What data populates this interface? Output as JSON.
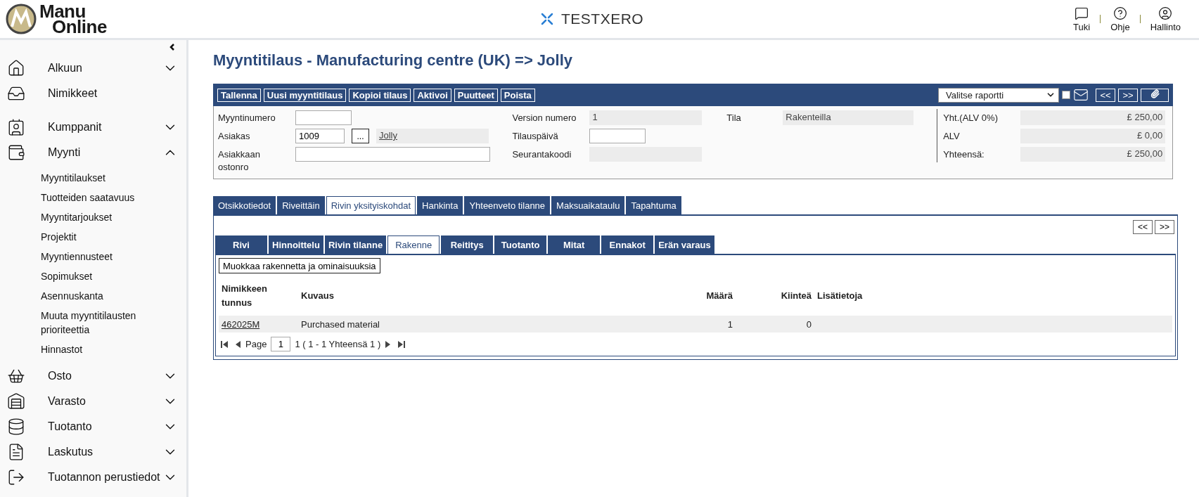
{
  "header": {
    "logo": {
      "line1": "Manu",
      "line2": "Online"
    },
    "brand": "TESTXERO",
    "actions": [
      {
        "label": "Tuki"
      },
      {
        "label": "Ohje"
      },
      {
        "label": "Hallinto"
      }
    ]
  },
  "sidebar": {
    "items": [
      {
        "label": "Alkuun",
        "expanded": false
      },
      {
        "label": "Nimikkeet"
      },
      {
        "label": "Kumppanit",
        "expanded": false
      },
      {
        "label": "Myynti",
        "expanded": true,
        "children": [
          "Myyntitilaukset",
          "Tuotteiden saatavuus",
          "Myyntitarjoukset",
          "Projektit",
          "Myyntiennusteet",
          "Sopimukset",
          "Asennuskanta",
          "Muuta myyntitilausten prioriteettia",
          "Hinnastot"
        ]
      },
      {
        "label": "Osto",
        "expanded": false
      },
      {
        "label": "Varasto",
        "expanded": false
      },
      {
        "label": "Tuotanto",
        "expanded": false
      },
      {
        "label": "Laskutus",
        "expanded": false
      },
      {
        "label": "Tuotannon perustiedot",
        "expanded": false
      }
    ]
  },
  "page_title": "Myyntitilaus - Manufacturing centre (UK) => Jolly",
  "toolbar": {
    "buttons": [
      "Tallenna",
      "Uusi myyntitilaus",
      "Kopioi tilaus",
      "Aktivoi",
      "Puutteet",
      "Poista"
    ],
    "report_select": "Valitse raportti",
    "email_checked": false,
    "nav": [
      "<<",
      ">>"
    ]
  },
  "form": {
    "customer": [
      {
        "label": "Myyntinumero",
        "kind": "input"
      },
      {
        "label": "Asiakas",
        "kind": "lookup",
        "value": "1009",
        "button": "...",
        "name": "Jolly"
      },
      {
        "label": "Asiakkaan ostonro",
        "kind": "wide"
      }
    ],
    "details": [
      {
        "label": "Version numero",
        "kind": "readonly",
        "value": "1"
      },
      {
        "label": "Tilauspäivä",
        "kind": "input"
      },
      {
        "label": "Seurantakoodi",
        "kind": "readonly"
      }
    ],
    "status": [
      {
        "label": "Tila",
        "kind": "readonly",
        "value": "Rakenteilla"
      }
    ],
    "totals": [
      {
        "label": "Yht.(ALV 0%)",
        "value": "£ 250,00"
      },
      {
        "label": "ALV",
        "value": "£ 0,00"
      },
      {
        "label": "Yhteensä:",
        "value": "£ 250,00"
      }
    ]
  },
  "tabs": [
    {
      "label": "Otsikkotiedot",
      "selected": false
    },
    {
      "label": "Riveittäin",
      "selected": false
    },
    {
      "label": "Rivin yksityiskohdat",
      "selected": true
    },
    {
      "label": "Hankinta",
      "selected": false
    },
    {
      "label": "Yhteenveto tilanne",
      "selected": false
    },
    {
      "label": "Maksuaikataulu",
      "selected": false
    },
    {
      "label": "Tapahtuma",
      "selected": false
    }
  ],
  "row_nav": [
    "<<",
    ">>"
  ],
  "subtabs": [
    {
      "label": "Rivi",
      "selected": false
    },
    {
      "label": "Hinnoittelu",
      "selected": false
    },
    {
      "label": "Rivin tilanne",
      "selected": false
    },
    {
      "label": "Rakenne",
      "selected": true
    },
    {
      "label": "Reititys",
      "selected": false
    },
    {
      "label": "Tuotanto",
      "selected": false
    },
    {
      "label": "Mitat",
      "selected": false
    },
    {
      "label": "Ennakot",
      "selected": false
    },
    {
      "label": "Erän varaus",
      "selected": false
    }
  ],
  "edit_button": "Muokkaa rakennetta ja ominaisuuksia",
  "table": {
    "columns": [
      "Nimikkeen tunnus",
      "Kuvaus",
      "Määrä",
      "Kiinteä",
      "Lisätietoja"
    ],
    "rows": [
      {
        "code": "462025M",
        "description": "Purchased material",
        "quantity": "1",
        "fixed": "0"
      }
    ]
  },
  "pager": {
    "label": "Page",
    "page": "1",
    "summary": "1 ( 1 - 1 Yhteensä 1 )"
  }
}
